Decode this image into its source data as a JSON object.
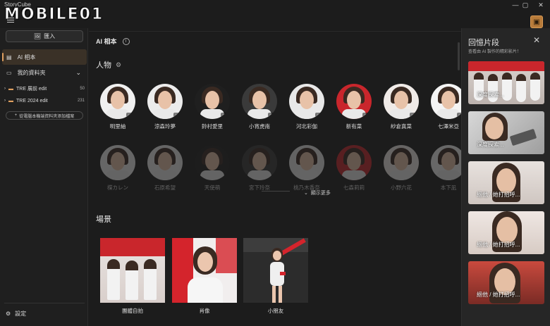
{
  "app": {
    "name": "StoryCube",
    "logo_text": "MOBILE01"
  },
  "window_controls": {
    "minimize": "—",
    "maximize": "▢",
    "close": "✕"
  },
  "sidebar": {
    "import_label": "匯入",
    "nav": [
      {
        "label": "AI 相本",
        "active": true
      },
      {
        "label": "我的資料夾",
        "active": false
      }
    ],
    "folders": [
      {
        "label": "TRE 展前 edit",
        "count": "50"
      },
      {
        "label": "TRE 2024 edit",
        "count": "231"
      }
    ],
    "add_folder_label": "從電腦本機端資料夾添加檔案",
    "settings_label": "設定"
  },
  "main": {
    "header": "AI 相本",
    "people_title": "人物",
    "people_row1": [
      "明里紬",
      "涼森玲夢",
      "鈴村愛里",
      "小宵虎南",
      "河北彩伽",
      "新有菜",
      "紗倉真菜",
      "七澤米亞"
    ],
    "people_row2": [
      "楪カレン",
      "石原希望",
      "天使萌",
      "宮下玲奈",
      "桃乃木香奈",
      "七森莉莉",
      "小野六花",
      "本下凪"
    ],
    "show_more": "顯示更多",
    "scenes_title": "場景",
    "scenes": [
      "團體自拍",
      "肖像",
      "小朋友"
    ]
  },
  "right_panel": {
    "title": "回憶片段",
    "subtitle": "查看由 AI 製作的精彩影片！",
    "memories": [
      "深度探索...",
      "深度探索...",
      "絕他 / 她打招呼...",
      "絕他 / 她打招呼...",
      "絕他 / 她打招呼..."
    ]
  },
  "colors": {
    "accent": "#e0a060",
    "background": "#1c1c1c",
    "panel": "#262626"
  }
}
